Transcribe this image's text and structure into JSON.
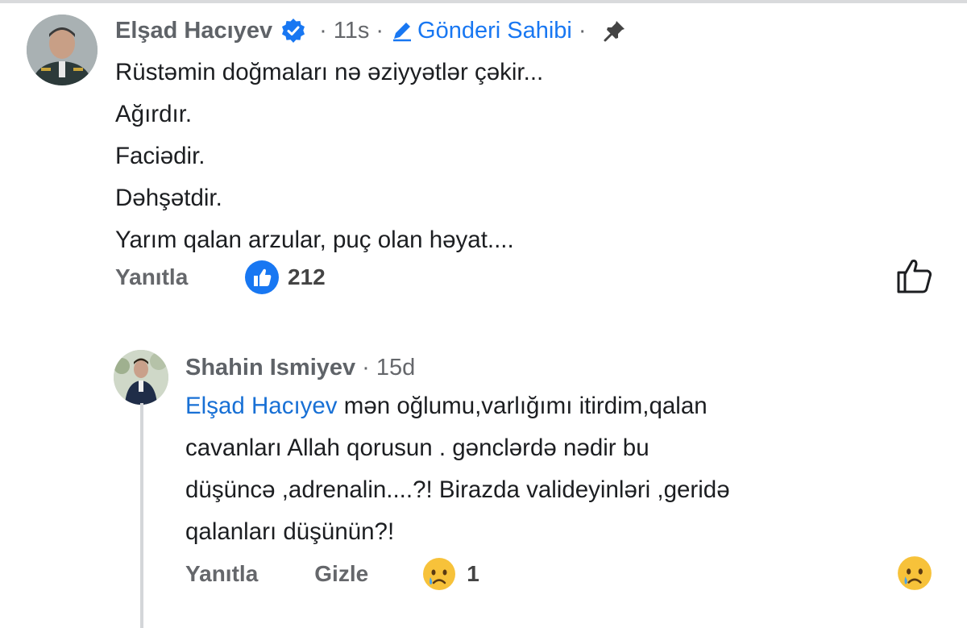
{
  "comment": {
    "author": "Elşad Hacıyev",
    "time": "11s",
    "owner_label": "Gönderi Sahibi",
    "lines": [
      "Rüstəmin doğmaları nə əziyyətlər çəkir...",
      "Ağırdır.",
      "Faciədir.",
      "Dəhşətdir.",
      "Yarım qalan arzular, puç olan həyat...."
    ],
    "reply_label": "Yanıtla",
    "like_count": "212",
    "icons": [
      "verified-badge-icon",
      "pencil-icon",
      "pin-icon",
      "like-reaction-icon",
      "thumbs-up-outline-icon"
    ],
    "colors": {
      "accent": "#1877f2",
      "meta": "#65676b"
    }
  },
  "reply": {
    "author": "Shahin Ismiyev",
    "time": "15d",
    "mention": "Elşad Hacıyev",
    "lines": [
      " mən oğlumu,varlığımı itirdim,qalan",
      "cavanları Allah qorusun . gənclərdə nədir bu",
      "düşüncə ,adrenalin....?! Birazda valideyinləri ,geridə",
      "qalanları düşünün?!"
    ],
    "reply_label": "Yanıtla",
    "hide_label": "Gizle",
    "sad_count": "1",
    "icons": [
      "sad-face-icon"
    ]
  },
  "separator": "·"
}
